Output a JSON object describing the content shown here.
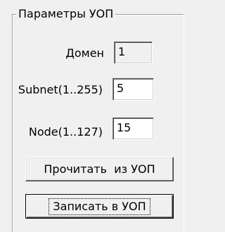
{
  "group": {
    "title": "Параметры УОП"
  },
  "fields": {
    "domain": {
      "label": "Домен",
      "value": "1"
    },
    "subnet": {
      "label": "Subnet(1..255)",
      "value": "5"
    },
    "node": {
      "label": "Node(1..127)",
      "value": "15"
    }
  },
  "buttons": {
    "read": "Прочитать  из УОП",
    "write": "Записать в УОП"
  }
}
